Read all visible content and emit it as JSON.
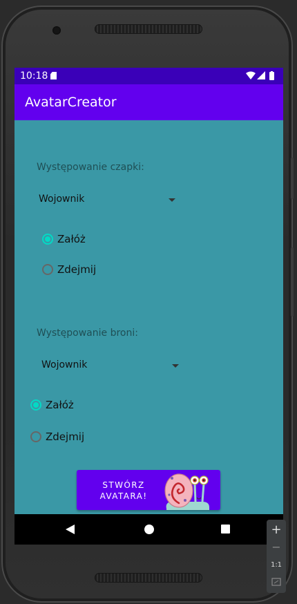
{
  "status_bar": {
    "time": "10:18",
    "icons": [
      "sd-card-icon",
      "wifi-icon",
      "signal-icon",
      "battery-icon"
    ]
  },
  "app_bar": {
    "title": "AvatarCreator"
  },
  "hat_section": {
    "label": "Występowanie czapki:",
    "spinner_value": "Wojownik",
    "radio_on": "Załóż",
    "radio_off": "Zdejmij",
    "selected": "Załóż"
  },
  "weapon_section": {
    "label": "Występowanie broni:",
    "spinner_value": "Wojownik",
    "radio_on": "Załóż",
    "radio_off": "Zdejmij",
    "selected": "Załóż"
  },
  "create_button": {
    "line1": "STWÓRZ",
    "line2": "AVATARA!",
    "image": "snail-avatar-icon"
  },
  "nav_bar": {
    "icons": [
      "back-icon",
      "home-icon",
      "recents-icon"
    ]
  },
  "emulator_zoom": {
    "plus": "+",
    "minus": "−",
    "ratio": "1:1"
  },
  "colors": {
    "status_bar": "#3a00b8",
    "app_bar": "#6200ee",
    "background": "#3a98a6",
    "radio_accent": "#03dac5",
    "button": "#6200ee"
  }
}
